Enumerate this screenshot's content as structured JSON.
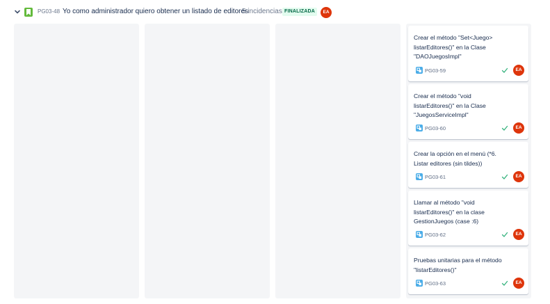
{
  "story": {
    "key": "PG03-48",
    "title": "Yo como administrador quiero obtener un listado de editores",
    "issue_count": "5 incidencias",
    "status": "FINALIZADA",
    "assignee_initials": "EA"
  },
  "colors": {
    "story_icon": "#63ba3c",
    "subtask_icon": "#4bade8",
    "avatar_bg": "#de350b",
    "done_check": "#36b37e",
    "lozenge_bg": "#e3fcef",
    "lozenge_text": "#006644",
    "column_bg": "#f4f5f7"
  },
  "cards": [
    {
      "summary": "Crear el método \"Set<Juego> listarEditores()\" en la Clase \"DAOJuegosImpl\"",
      "key": "PG03-59",
      "initials": "EA"
    },
    {
      "summary": "Crear el método \"void listarEditores()\" en la Clase \"JuegosServiceImpl\"",
      "key": "PG03-60",
      "initials": "EA"
    },
    {
      "summary": "Crear la opción en el menú (*6. Listar editores (sin tildes))",
      "key": "PG03-61",
      "initials": "EA"
    },
    {
      "summary": "Llamar al método \"void listarEditores()\" en la clase GestionJuegos (case :6)",
      "key": "PG03-62",
      "initials": "EA"
    },
    {
      "summary": "Pruebas unitarias para el método \"listarEditores()\"",
      "key": "PG03-63",
      "initials": "EA"
    }
  ]
}
